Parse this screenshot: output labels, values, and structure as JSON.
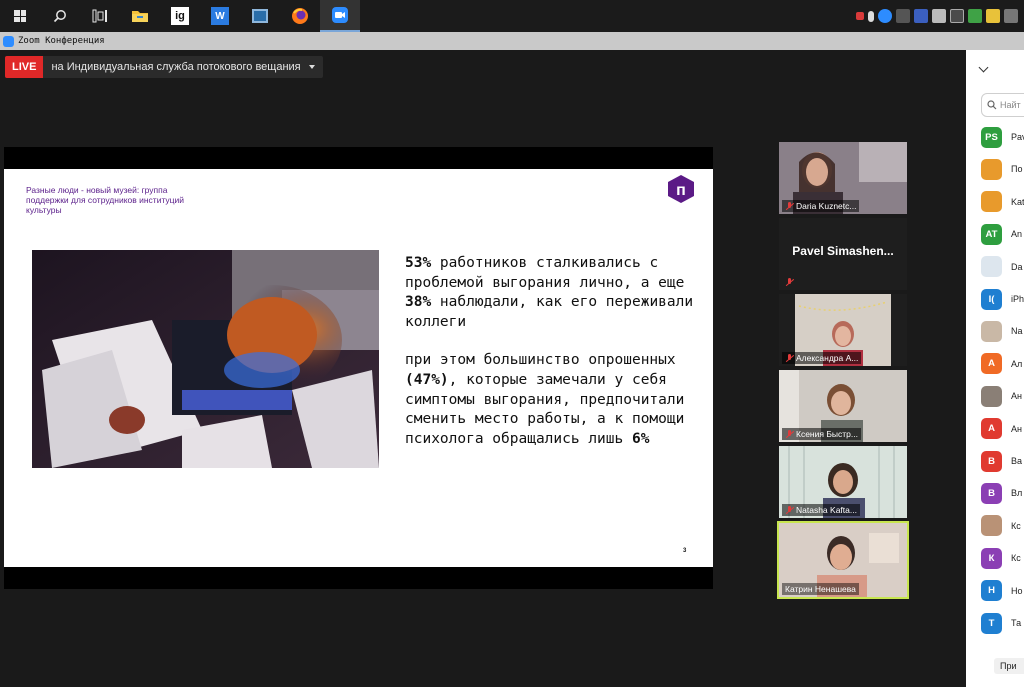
{
  "taskbar": {
    "apps": [
      {
        "name": "start",
        "label": ""
      },
      {
        "name": "search",
        "label": ""
      },
      {
        "name": "task-view",
        "label": ""
      },
      {
        "name": "file-explorer",
        "label": ""
      },
      {
        "name": "ig-app",
        "label": "ig"
      },
      {
        "name": "w-app",
        "label": "W"
      },
      {
        "name": "window-app",
        "label": ""
      },
      {
        "name": "firefox",
        "label": ""
      },
      {
        "name": "zoom",
        "label": ""
      }
    ]
  },
  "window": {
    "title": "Zoom Конференция"
  },
  "live": {
    "badge": "LIVE",
    "destination": "на Индивидуальная служба потокового вещания"
  },
  "slide": {
    "header": "Разные люди - новый музей: группа поддержки для сотрудников институций культуры",
    "logo_letter": "п",
    "p1_a": "53%",
    "p1_b": " работников сталкивались с проблемой выгорания лично, а еще ",
    "p1_c": "38%",
    "p1_d": " наблюдали, как его переживали коллеги",
    "p2_a": "при этом большинство опрошенных ",
    "p2_b": "(47%)",
    "p2_c": ", которые замечали у себя симптомы выгорания, предпочитали сменить место работы, а к помощи психолога обращались лишь ",
    "p2_d": "6%",
    "page_number": "3"
  },
  "tiles": [
    {
      "name": "Daria Kuznetc...",
      "muted": true
    },
    {
      "name": "Pavel Simashen...",
      "big_name": "Pavel  Simashen...",
      "muted": true
    },
    {
      "name": "Александра А...",
      "muted": true
    },
    {
      "name": "Ксения Быстр...",
      "muted": true
    },
    {
      "name": "Natasha Kafta...",
      "muted": true
    },
    {
      "name": "Катрин Ненашева",
      "muted": false
    }
  ],
  "sidebar": {
    "search_placeholder": "Найт",
    "participants": [
      {
        "initials": "PS",
        "color": "#2e9e3f",
        "name": "Pav"
      },
      {
        "initials": "",
        "color": "#e89a2c",
        "name": "По"
      },
      {
        "initials": "",
        "color": "#e89a2c",
        "name": "Kat"
      },
      {
        "initials": "AT",
        "color": "#2e9e3f",
        "name": "An"
      },
      {
        "initials": "",
        "color": "#dde6ee",
        "name": "Da"
      },
      {
        "initials": "I(",
        "color": "#1f7fd1",
        "name": "iPh"
      },
      {
        "initials": "",
        "color": "#c9b8a6",
        "name": "Na"
      },
      {
        "initials": "А",
        "color": "#f06a25",
        "name": "Ал"
      },
      {
        "initials": "",
        "color": "#8a7f76",
        "name": "Ан"
      },
      {
        "initials": "А",
        "color": "#e03a30",
        "name": "Ан"
      },
      {
        "initials": "В",
        "color": "#e03a30",
        "name": "Ва"
      },
      {
        "initials": "В",
        "color": "#8b3fb4",
        "name": "Вл"
      },
      {
        "initials": "",
        "color": "#b99276",
        "name": "Кс"
      },
      {
        "initials": "К",
        "color": "#8b3fb4",
        "name": "Кс"
      },
      {
        "initials": "Н",
        "color": "#1f7fd1",
        "name": "Но"
      },
      {
        "initials": "Т",
        "color": "#1f7fd1",
        "name": "Та"
      }
    ],
    "bottom_button": "При"
  }
}
